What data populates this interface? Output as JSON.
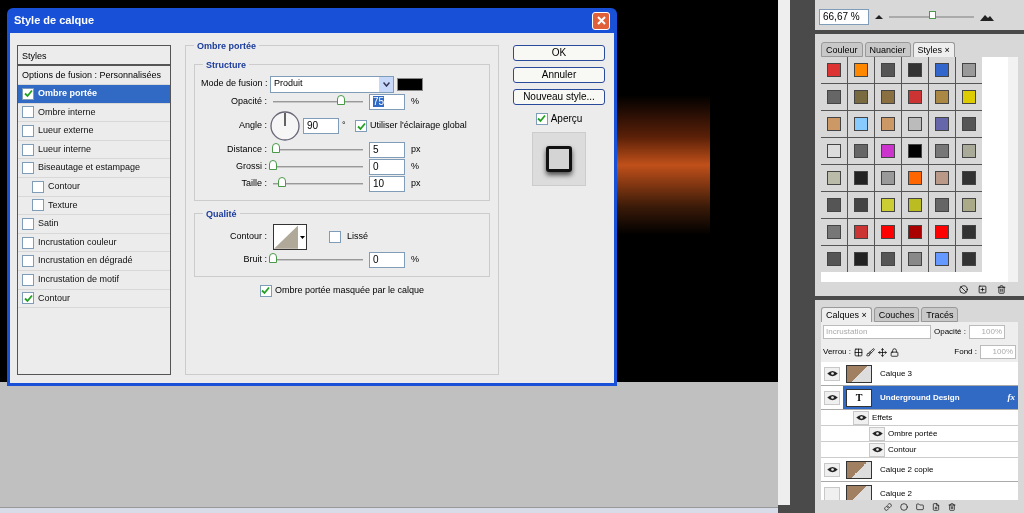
{
  "dialog": {
    "title": "Style de calque",
    "styles_list": {
      "header": "Styles",
      "blending": "Options de fusion : Personnalisées",
      "items": [
        {
          "label": "Ombre portée",
          "checked": true,
          "selected": true
        },
        {
          "label": "Ombre interne",
          "checked": false,
          "selected": false
        },
        {
          "label": "Lueur externe",
          "checked": false,
          "selected": false
        },
        {
          "label": "Lueur interne",
          "checked": false,
          "selected": false
        },
        {
          "label": "Biseautage et estampage",
          "checked": false,
          "selected": false,
          "children": [
            {
              "label": "Contour",
              "checked": false,
              "selected": false
            },
            {
              "label": "Texture",
              "checked": false,
              "selected": false
            }
          ]
        },
        {
          "label": "Satin",
          "checked": false,
          "selected": false
        },
        {
          "label": "Incrustation couleur",
          "checked": false,
          "selected": false
        },
        {
          "label": "Incrustation en dégradé",
          "checked": false,
          "selected": false
        },
        {
          "label": "Incrustation de motif",
          "checked": false,
          "selected": false
        },
        {
          "label": "Contour",
          "checked": true,
          "selected": false
        }
      ]
    },
    "section_title": "Ombre portée",
    "structure": {
      "title": "Structure",
      "blend_label": "Mode de fusion :",
      "blend_value": "Produit",
      "opacity": {
        "label": "Opacité :",
        "level": 0.75,
        "value": "75",
        "unit": "%"
      },
      "angle": {
        "label": "Angle :",
        "value": "90",
        "unit": "°",
        "global": {
          "label": "Utiliser l'éclairage global",
          "checked": true
        }
      },
      "sliders": [
        {
          "label": "Distance :",
          "level": 0.03,
          "value": "5",
          "unit": "px"
        },
        {
          "label": "Grossi :",
          "level": 0,
          "value": "0",
          "unit": "%"
        },
        {
          "label": "Taille :",
          "level": 0.1,
          "value": "10",
          "unit": "px"
        }
      ]
    },
    "quality": {
      "title": "Qualité",
      "contour_label": "Contour :",
      "smooth": {
        "label": "Lissé",
        "checked": false
      },
      "noise": {
        "label": "Bruit :",
        "level": 0,
        "value": "0",
        "unit": "%"
      }
    },
    "layer_knocks_out": {
      "label": "Ombre portée masquée par le calque",
      "checked": true
    },
    "buttons": [
      "OK",
      "Annuler",
      "Nouveau style..."
    ],
    "preview": {
      "label": "Aperçu",
      "checked": true
    }
  },
  "navigator": {
    "zoom": "66,67 %",
    "level": 0.5
  },
  "styles_panel": {
    "tabs": [
      {
        "label": "Couleur",
        "selected": false
      },
      {
        "label": "Nuancier",
        "selected": false
      },
      {
        "label": "Styles",
        "selected": true,
        "close": "×"
      }
    ]
  },
  "layers_panel": {
    "tabs": [
      {
        "label": "Calques",
        "selected": true,
        "close": "×"
      },
      {
        "label": "Couches",
        "selected": false
      },
      {
        "label": "Tracés",
        "selected": false
      }
    ],
    "blend_mode": "Incrustation",
    "opacity_label": "Opacité :",
    "opacity": "100%",
    "lock_label": "Verrou :",
    "fill_label": "Fond :",
    "fill": "100%",
    "layers": [
      {
        "kind": "layer",
        "name": "Calque 3",
        "visible": true,
        "selected": false
      },
      {
        "kind": "layer",
        "name": "Underground Design",
        "visible": true,
        "selected": true,
        "thumb_text": "T",
        "fx": "fx"
      },
      {
        "kind": "effects",
        "name": "Effets",
        "visible": true,
        "selected": false
      },
      {
        "kind": "effect",
        "name": "Ombre portée",
        "visible": true,
        "selected": false
      },
      {
        "kind": "effect",
        "name": "Contour",
        "visible": true,
        "selected": false
      },
      {
        "kind": "layer",
        "name": "Calque 2 copie",
        "visible": true,
        "selected": false
      },
      {
        "kind": "layer",
        "name": "Calque 2",
        "visible": false,
        "selected": false
      }
    ]
  }
}
